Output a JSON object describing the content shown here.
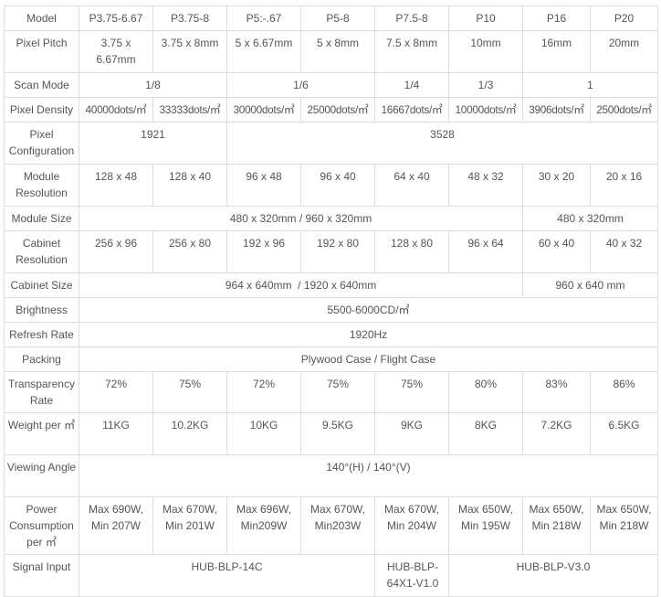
{
  "table": {
    "models": [
      "P3.75-6.67",
      "P3.75-8",
      "P5:-.67",
      "P5-8",
      "P7.5-8",
      "P10",
      "P16",
      "P20"
    ],
    "rows": {
      "model": {
        "label": "Model"
      },
      "pixel_pitch": {
        "label": "Pixel Pitch",
        "values": [
          "3.75 x 6.67mm",
          "3.75 x 8mm",
          "5 x 6.67mm",
          "5 x 8mm",
          "7.5 x 8mm",
          "10mm",
          "16mm",
          "20mm"
        ]
      },
      "scan_mode": {
        "label": "Scan Mode",
        "groups": [
          "1/8",
          "1/6",
          "1/4",
          "1/3",
          "1"
        ]
      },
      "pixel_density": {
        "label": "Pixel Density",
        "values": [
          "40000dots/㎡",
          "33333dots/㎡",
          "30000dots/㎡",
          "25000dots/㎡",
          "16667dots/㎡",
          "10000dots/㎡",
          "3906dots/㎡",
          "2500dots/㎡"
        ]
      },
      "pixel_configuration": {
        "label": "Pixel Configuration",
        "groups": [
          "1921",
          "3528"
        ]
      },
      "module_resolution": {
        "label": "Module Resolution",
        "values": [
          "128 x 48",
          "128 x 40",
          "96 x 48",
          "96 x 40",
          "64 x 40",
          "48 x 32",
          "30 x 20",
          "20 x 16"
        ]
      },
      "module_size": {
        "label": "Module Size",
        "groups": [
          "480 x 320mm / 960 x 320mm",
          "480 x 320mm"
        ]
      },
      "cabinet_resolution": {
        "label": "Cabinet Resolution",
        "values": [
          "256 x 96",
          "256 x 80",
          "192 x 96",
          "192 x 80",
          "128 x 80",
          "96 x 64",
          "60 x 40",
          "40 x 32"
        ]
      },
      "cabinet_size": {
        "label": "Cabinet Size",
        "groups": [
          "964 x 640mm  / 1920 x 640mm",
          "960 x 640 mm"
        ]
      },
      "brightness": {
        "label": "Brightness",
        "value": "5500-6000CD/㎡"
      },
      "refresh_rate": {
        "label": "Refresh Rate",
        "value": "1920Hz"
      },
      "packing": {
        "label": "Packing",
        "value": "Plywood Case / Flight Case"
      },
      "transparency_rate": {
        "label": "Transparency Rate",
        "values": [
          "72%",
          "75%",
          "72%",
          "75%",
          "75%",
          "80%",
          "83%",
          "86%"
        ]
      },
      "weight": {
        "label": "Weight per ㎡",
        "values": [
          "11KG",
          "10.2KG",
          "10KG",
          "9.5KG",
          "9KG",
          "8KG",
          "7.2KG",
          "6.5KG"
        ]
      },
      "viewing_angle": {
        "label": "Viewing Angle",
        "value": "140°(H) / 140°(V)"
      },
      "power_consumption": {
        "label": "Power Consumption per ㎡",
        "values": [
          "Max 690W, Min 207W",
          "Max 670W, Min 201W",
          "Max 696W, Min209W",
          "Max 670W, Min203W",
          "Max 670W, Min 204W",
          "Max 650W, Min 195W",
          "Max 650W, Min 218W",
          "Max 650W, Min 218W"
        ]
      },
      "signal_input": {
        "label": "Signal Input",
        "groups": [
          "HUB-BLP-14C",
          "HUB-BLP-64X1-V1.0",
          "HUB-BLP-V3.0"
        ]
      }
    }
  }
}
